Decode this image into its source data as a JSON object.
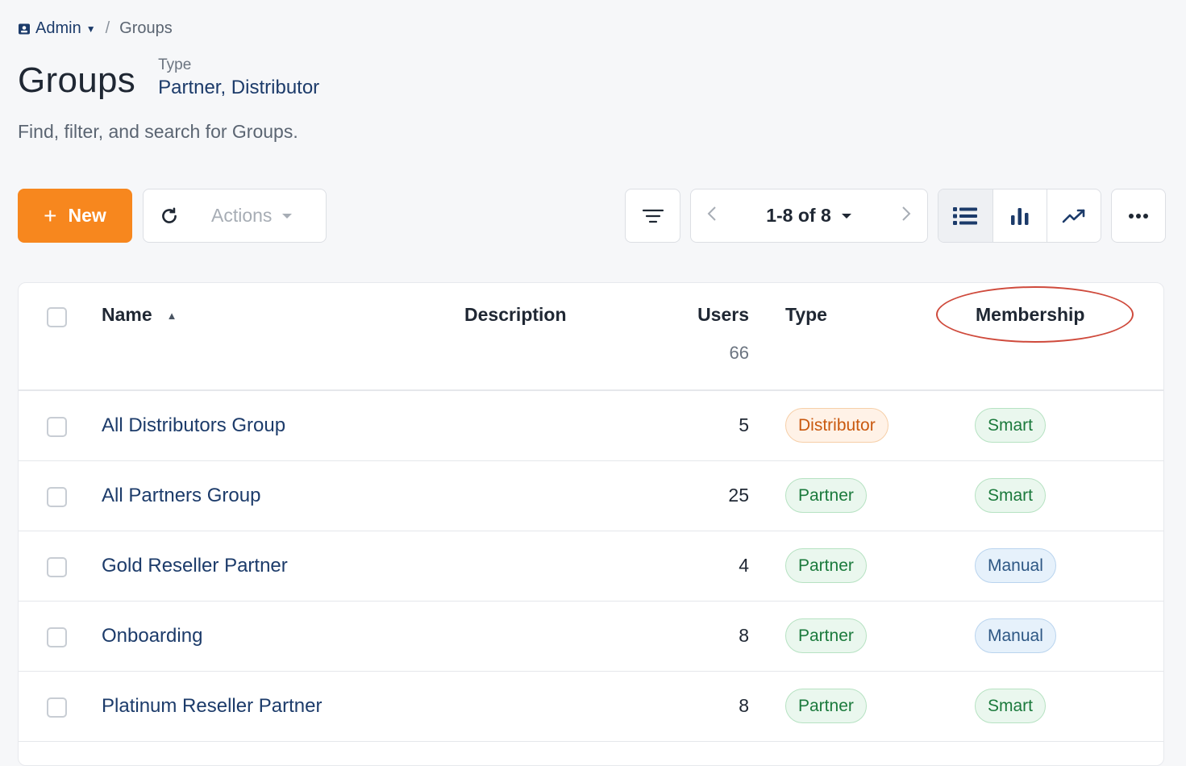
{
  "breadcrumb": {
    "admin_label": "Admin",
    "current": "Groups"
  },
  "header": {
    "title": "Groups",
    "filter_label": "Type",
    "filter_value": "Partner, Distributor",
    "subtitle": "Find, filter, and search for Groups."
  },
  "toolbar": {
    "new_label": "New",
    "actions_label": "Actions",
    "pager_label": "1-8 of 8"
  },
  "table": {
    "columns": {
      "name": "Name",
      "description": "Description",
      "users": "Users",
      "type": "Type",
      "membership": "Membership"
    },
    "users_total": "66",
    "rows": [
      {
        "name": "All Distributors Group",
        "description": "",
        "users": "5",
        "type": "Distributor",
        "membership": "Smart"
      },
      {
        "name": "All Partners Group",
        "description": "",
        "users": "25",
        "type": "Partner",
        "membership": "Smart"
      },
      {
        "name": "Gold Reseller Partner",
        "description": "",
        "users": "4",
        "type": "Partner",
        "membership": "Manual"
      },
      {
        "name": "Onboarding",
        "description": "",
        "users": "8",
        "type": "Partner",
        "membership": "Manual"
      },
      {
        "name": "Platinum Reseller Partner",
        "description": "",
        "users": "8",
        "type": "Partner",
        "membership": "Smart"
      }
    ]
  },
  "colors": {
    "accent_orange": "#f7871e",
    "link_navy": "#1c3b6a",
    "annotation_red": "#cf4a3c"
  }
}
